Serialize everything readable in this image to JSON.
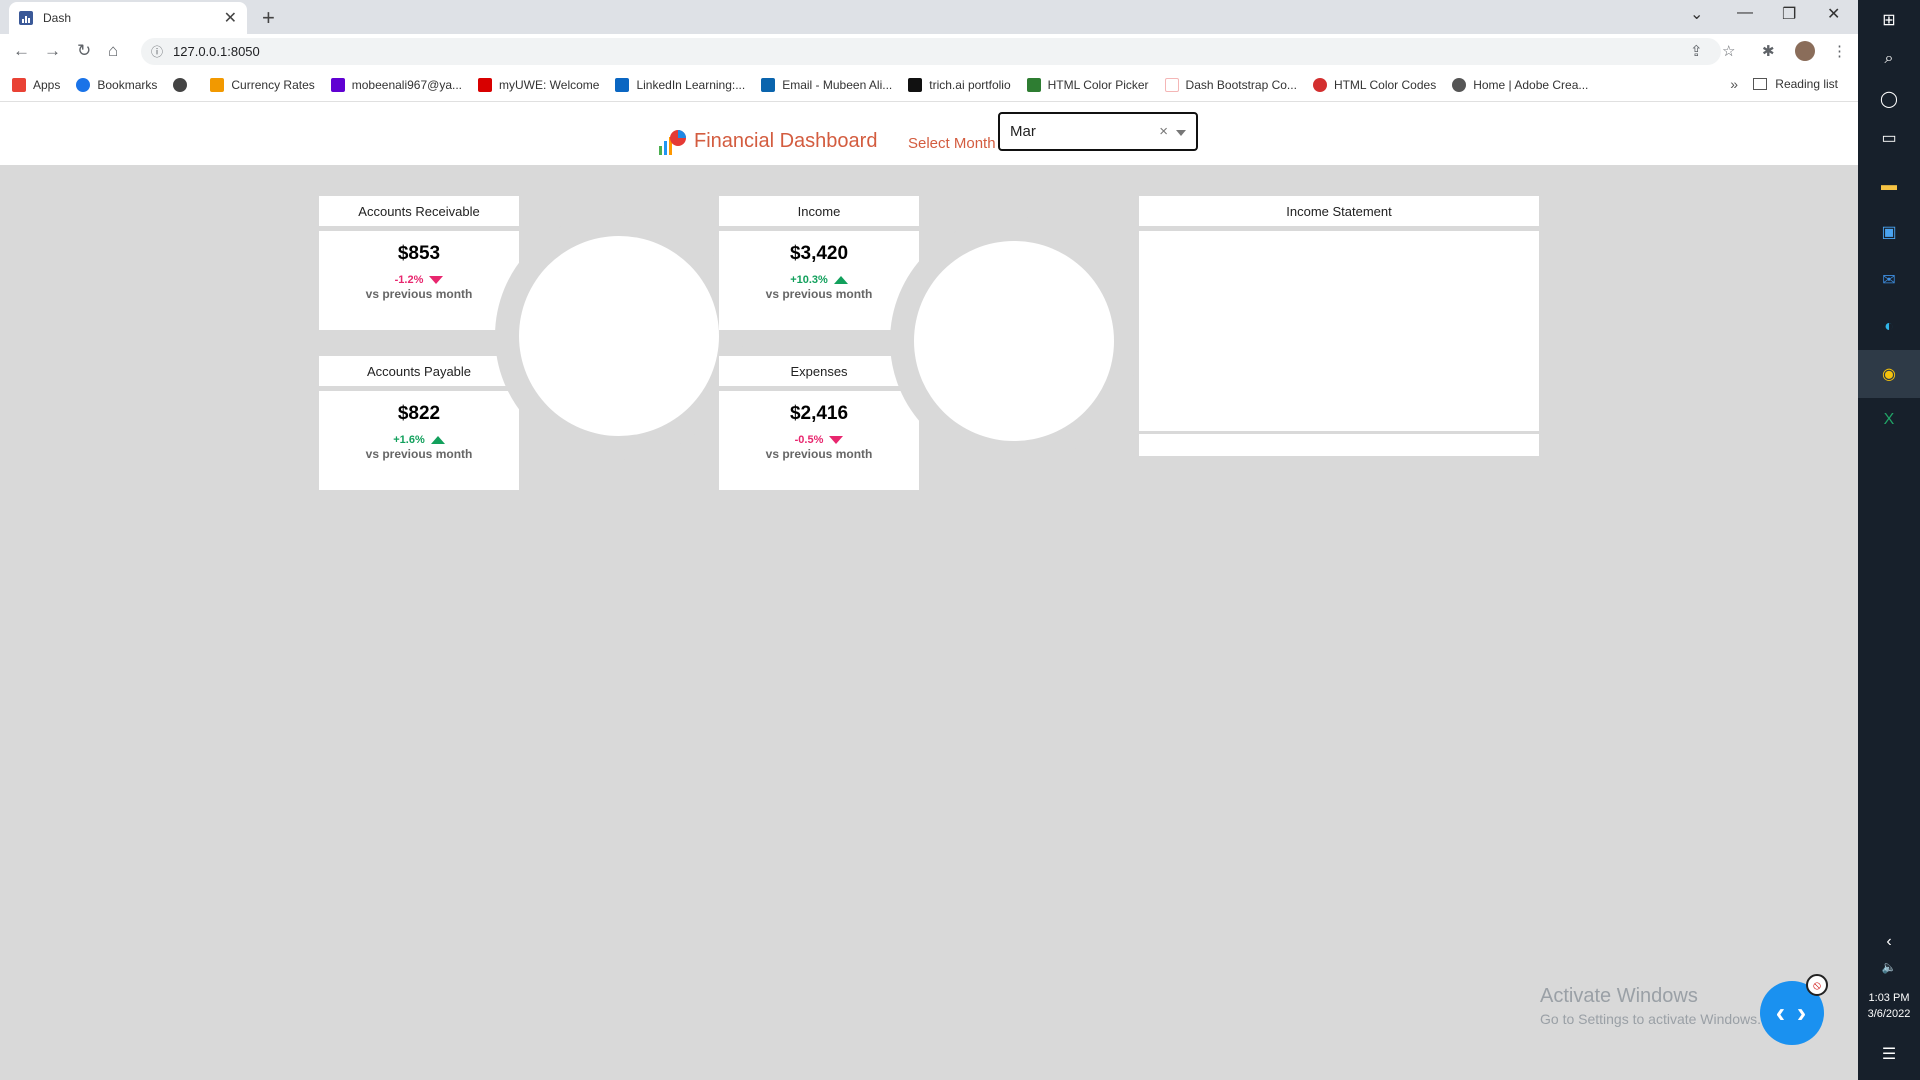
{
  "browser": {
    "tab_title": "Dash",
    "url": "127.0.0.1:8050",
    "bookmarks": [
      {
        "label": "Apps",
        "color": "#e94235"
      },
      {
        "label": "Bookmarks",
        "color": "#1a73e8"
      },
      {
        "label": "",
        "color": "#444444"
      },
      {
        "label": "Currency Rates",
        "color": "#f29900"
      },
      {
        "label": "mobeenali967@ya...",
        "color": "#6001d2"
      },
      {
        "label": "myUWE: Welcome",
        "color": "#d80000"
      },
      {
        "label": "LinkedIn Learning:...",
        "color": "#0a66c2"
      },
      {
        "label": "Email - Mubeen Ali...",
        "color": "#0a64ad"
      },
      {
        "label": "trich.ai portfolio",
        "color": "#111111"
      },
      {
        "label": "HTML Color Picker",
        "color": "#2e7d32"
      },
      {
        "label": "Dash Bootstrap Co...",
        "color": "#f4b6b6"
      },
      {
        "label": "HTML Color Codes",
        "color": "#d32f2f"
      },
      {
        "label": "Home | Adobe Crea...",
        "color": "#555555"
      }
    ],
    "reading_list": "Reading list"
  },
  "app": {
    "title": "Financial Dashboard",
    "month_label": "Select Month",
    "month_value": "Mar"
  },
  "cards": {
    "ar": {
      "title": "Accounts Receivable",
      "value": "$853",
      "change": "-1.2%",
      "direction": "down",
      "sub": "vs previous month"
    },
    "ap": {
      "title": "Accounts Payable",
      "value": "$822",
      "change": "+1.6%",
      "direction": "up",
      "sub": "vs previous month"
    },
    "income": {
      "title": "Income",
      "value": "$3,420",
      "change": "+10.3%",
      "direction": "up",
      "sub": "vs previous month"
    },
    "expenses": {
      "title": "Expenses",
      "value": "$2,416",
      "change": "-0.5%",
      "direction": "down",
      "sub": "vs previous month"
    },
    "income_statement": {
      "title": "Income Statement"
    }
  },
  "colors": {
    "negative": "#e8266e",
    "positive": "#12a05c",
    "title": "#d35c3f"
  },
  "system": {
    "time": "1:03 PM",
    "date": "3/6/2022",
    "activate_title": "Activate Windows",
    "activate_sub": "Go to Settings to activate Windows."
  }
}
